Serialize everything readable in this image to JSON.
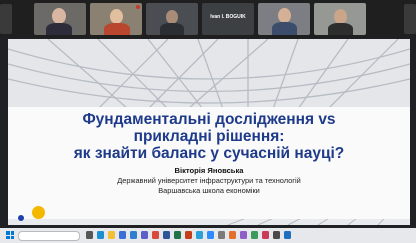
{
  "participants": [
    {
      "name": "",
      "style": "woman-light"
    },
    {
      "name": "",
      "style": "woman-blonde"
    },
    {
      "name": "",
      "style": "person-dark"
    },
    {
      "name": "",
      "style": "named"
    },
    {
      "name": "",
      "style": "man"
    },
    {
      "name": "",
      "style": "man-glasses"
    }
  ],
  "named_tile_label": "Іvan I. BOGUIK",
  "slide": {
    "title_line1": "Фундаментальні дослідження vs",
    "title_line2": "прикладні рішення:",
    "title_line3": "як знайти баланс у сучасній науці?",
    "author": "Вікторія Яновська",
    "affiliation_line1": "Державний університет інфраструктури та технологій",
    "affiliation_line2": "Варшавська школа економіки"
  },
  "colors": {
    "title": "#1e3a8a",
    "accent_yellow": "#f5b800",
    "accent_blue": "#1e40af"
  }
}
